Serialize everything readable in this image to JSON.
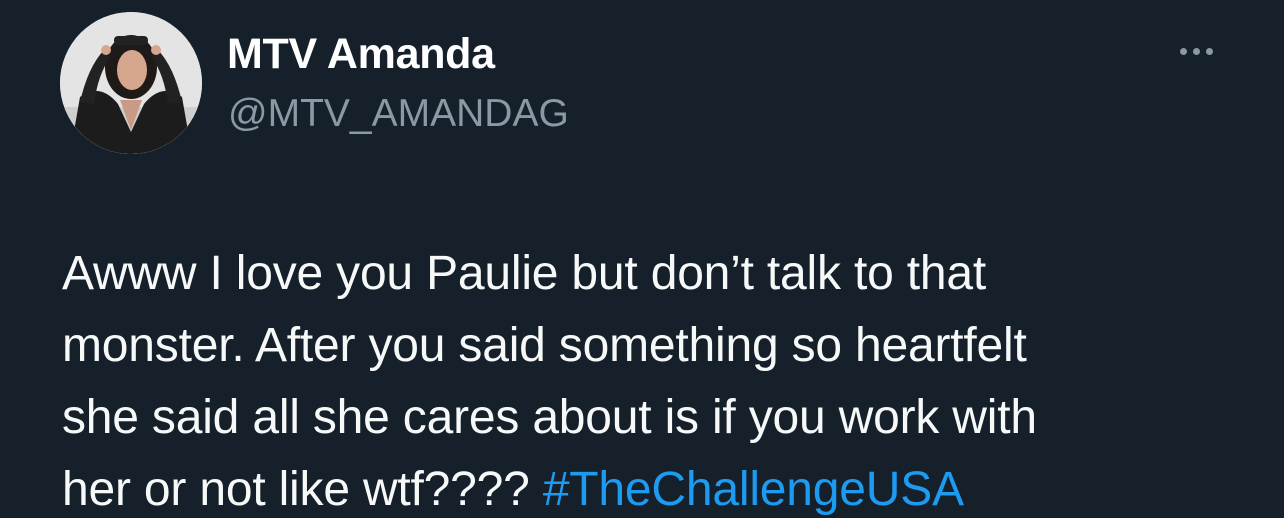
{
  "author": {
    "display_name": "MTV Amanda",
    "handle": "@MTV_AMANDAG",
    "avatar_icon": "profile-photo"
  },
  "menu": {
    "more_icon": "more-horizontal-icon"
  },
  "tweet": {
    "lines": [
      "Awww I love you Paulie but don’t talk to that",
      "monster. After you said something so heartfelt",
      "she said all she cares about is if you work with",
      "her or not like wtf????"
    ],
    "hashtag": "#TheChallengeUSA"
  },
  "colors": {
    "background": "#15202b",
    "text": "#f7f9f9",
    "secondary_text": "#8b98a5",
    "link": "#1d9bf0"
  }
}
